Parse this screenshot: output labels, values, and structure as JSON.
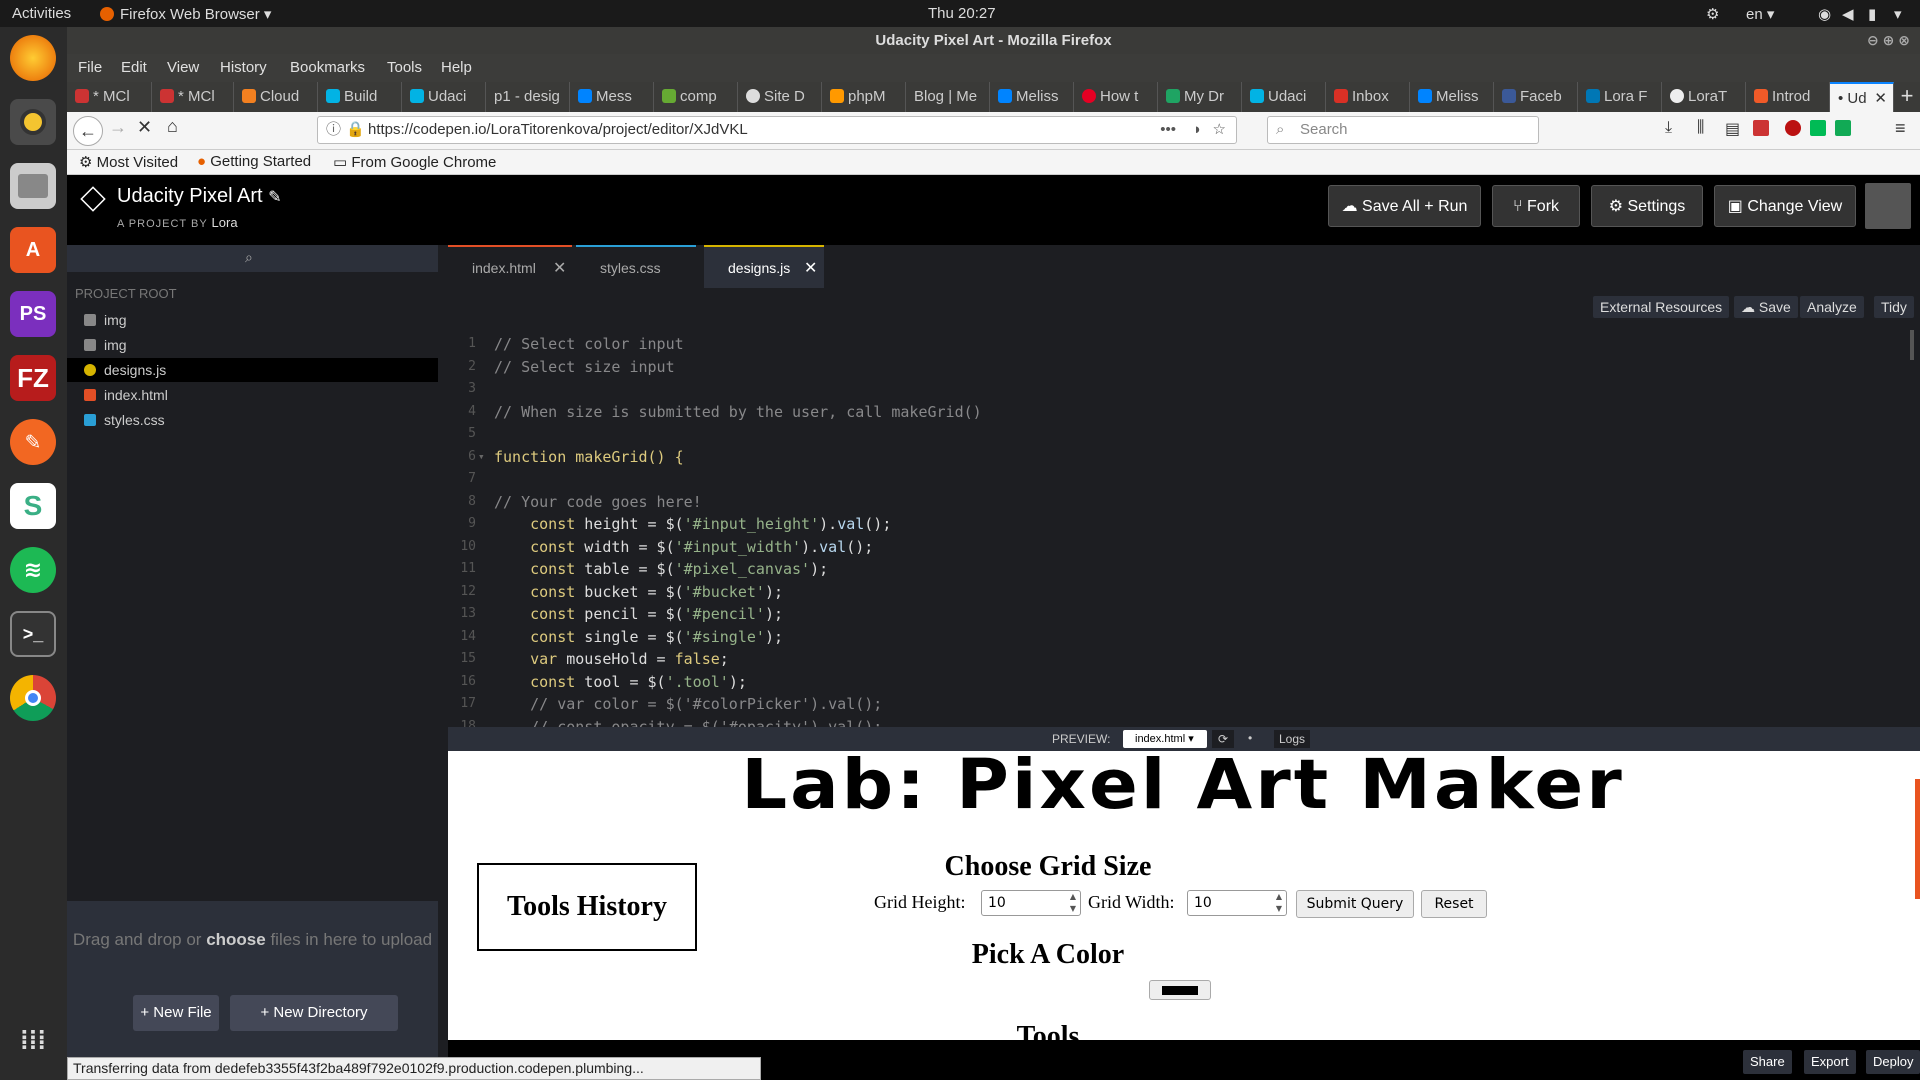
{
  "system": {
    "activities": "Activities",
    "app_name": "Firefox Web Browser",
    "clock": "Thu 20:27",
    "lang": "en"
  },
  "window_title": "Udacity Pixel Art - Mozilla Firefox",
  "menu": [
    "File",
    "Edit",
    "View",
    "History",
    "Bookmarks",
    "Tools",
    "Help"
  ],
  "tabs": [
    "* MCl",
    "* MCl",
    "Cloud",
    "Build",
    "Udaci",
    "p1 - desig",
    "Mess",
    "comp",
    "Site D",
    "phpM",
    "Blog | Me",
    "Meliss",
    "How t",
    "My Dr",
    "Udaci",
    "Inbox",
    "Meliss",
    "Faceb",
    "Lora F",
    "LoraT",
    "Introd",
    "• Ud"
  ],
  "url": "https://codepen.io/LoraTitorenkova/project/editor/XJdVKL",
  "search_placeholder": "Search",
  "bookmarks": [
    "Most Visited",
    "Getting Started",
    "From Google Chrome"
  ],
  "codepen": {
    "project_title": "Udacity Pixel Art",
    "by_label": "A PROJECT BY",
    "author": "Lora",
    "buttons": {
      "save_run": "Save All + Run",
      "fork": "Fork",
      "settings": "Settings",
      "change_view": "Change View"
    },
    "sidebar": {
      "root_label": "PROJECT ROOT",
      "items": [
        {
          "name": "img",
          "type": "folder"
        },
        {
          "name": "img",
          "type": "folder"
        },
        {
          "name": "designs.js",
          "type": "js"
        },
        {
          "name": "index.html",
          "type": "html"
        },
        {
          "name": "styles.css",
          "type": "css"
        }
      ],
      "drop_text_1": "Drag and drop or",
      "drop_choose": "choose",
      "drop_text_2": "files in here to upload",
      "new_file": "+ New File",
      "new_directory": "+ New Directory"
    },
    "editor_tabs": [
      "index.html",
      "styles.css",
      "designs.js"
    ],
    "editor_tools": [
      "External Resources",
      "Save",
      "Analyze",
      "Tidy"
    ],
    "code_lines": [
      "// Select color input",
      "// Select size input",
      "",
      "// When size is submitted by the user, call makeGrid()",
      "",
      "function makeGrid() {",
      "",
      "// Your code goes here!",
      "    const height = $('#input_height').val();",
      "    const width = $('#input_width').val();",
      "    const table = $('#pixel_canvas');",
      "    const bucket = $('#bucket');",
      "    const pencil = $('#pencil');",
      "    const single = $('#single');",
      "    var mouseHold = false;",
      "    const tool = $('.tool');",
      "    // var color = $('#colorPicker').val();",
      "    // const opacity = $('#opacity').val();"
    ],
    "preview_label": "PREVIEW:",
    "preview_file": "index.html",
    "logs_label": "Logs",
    "preview": {
      "title": "Lab: Pixel Art Maker",
      "tools_history": "Tools History",
      "choose_grid": "Choose Grid Size",
      "grid_height_label": "Grid Height:",
      "grid_height": "10",
      "grid_width_label": "Grid Width:",
      "grid_width": "10",
      "submit": "Submit Query",
      "reset": "Reset",
      "pick_color": "Pick A Color",
      "tools": "Tools"
    },
    "bottom_buttons": [
      "Share",
      "Export",
      "Deploy"
    ]
  },
  "status_text": "Transferring data from dedefeb3355f43f2ba489f792e0102f9.production.codepen.plumbing..."
}
